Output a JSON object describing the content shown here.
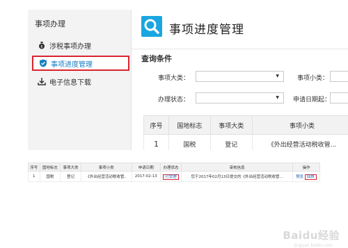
{
  "sidebar": {
    "title": "事项办理",
    "items": [
      {
        "label": "涉税事项办理",
        "icon": "moneybag-icon"
      },
      {
        "label": "事项进度管理",
        "icon": "shield-icon",
        "active": true
      },
      {
        "label": "电子信息下载",
        "icon": "download-icon"
      }
    ]
  },
  "main": {
    "title": "事项进度管理",
    "section_title": "查询条件",
    "filters": {
      "category_label": "事项大类：",
      "subcategory_label": "事项小类：",
      "status_label": "办理状态：",
      "date_label": "申请日期起："
    },
    "table": {
      "headers": [
        "序号",
        "国地标志",
        "事项大类",
        "事项小类"
      ],
      "rows": [
        [
          "1",
          "国税",
          "登记",
          "《外出经营活动税收管..."
        ]
      ]
    }
  },
  "bottom_table": {
    "headers": [
      "序号",
      "国地标志",
      "事项大类",
      "事项小类",
      "申请日期",
      "办理状态",
      "审核信息",
      "操作"
    ],
    "row": {
      "index": "1",
      "flag": "国税",
      "category": "登记",
      "subcategory": "《外出经营活动税收管..",
      "date": "2017-02-13",
      "status": "已受理",
      "audit": "您于2017年02月13日提交的《外出经营活动税收管...",
      "action_view": "预览",
      "action_receipt": "回执"
    }
  },
  "watermark": {
    "main": "Baidu经验",
    "sub": "jingyan.baidu.com"
  },
  "colors": {
    "accent": "#1aa6e0",
    "highlight": "#d9242e",
    "link": "#1a5fb4"
  }
}
